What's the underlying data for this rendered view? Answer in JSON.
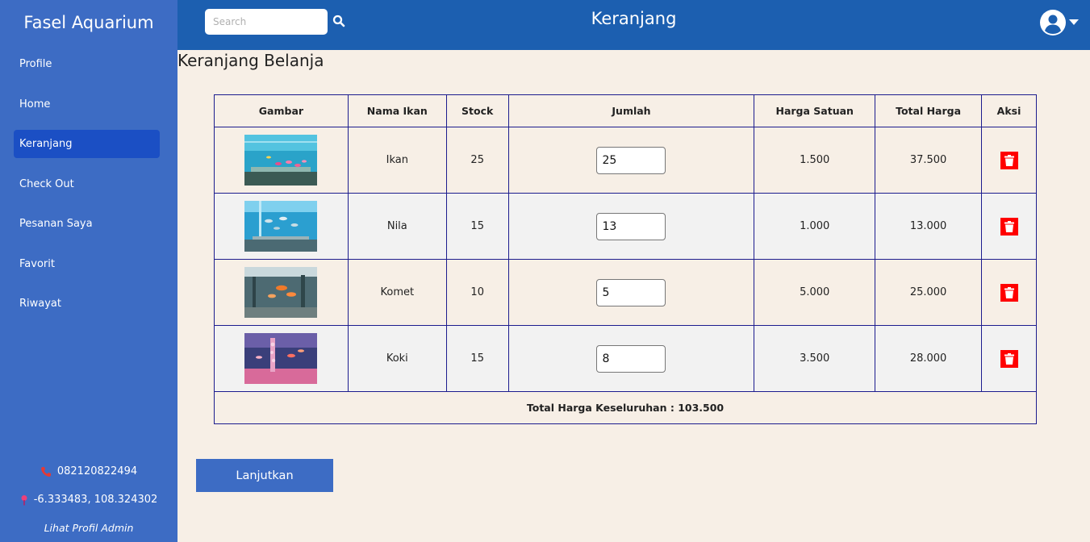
{
  "brand": "Fasel Aquarium",
  "sidebar": {
    "items": [
      {
        "label": "Profile"
      },
      {
        "label": "Home"
      },
      {
        "label": "Keranjang"
      },
      {
        "label": "Check Out"
      },
      {
        "label": "Pesanan Saya"
      },
      {
        "label": "Favorit"
      },
      {
        "label": "Riwayat"
      }
    ],
    "active_item": "Keranjang",
    "phone": "082120822494",
    "location": "-6.333483, 108.324302",
    "admin_link": "Lihat Profil Admin",
    "phone_icon": "phone-icon",
    "location_icon": "map-pin-icon"
  },
  "header": {
    "title": "Keranjang",
    "search_placeholder": "Search",
    "search_icon": "search-icon",
    "user_icon": "user-circle-icon",
    "dropdown_icon": "caret-down-icon"
  },
  "main": {
    "title": "Keranjang Belanja",
    "table": {
      "headers": [
        "Gambar",
        "Nama Ikan",
        "Stock",
        "Jumlah",
        "Harga Satuan",
        "Total Harga",
        "Aksi"
      ],
      "rows": [
        {
          "name": "Ikan",
          "stock": "25",
          "qty": "25",
          "unit_price": "1.500",
          "total": "37.500",
          "image": "aquarium-photo"
        },
        {
          "name": "Nila",
          "stock": "15",
          "qty": "13",
          "unit_price": "1.000",
          "total": "13.000",
          "image": "aquarium-photo"
        },
        {
          "name": "Komet",
          "stock": "10",
          "qty": "5",
          "unit_price": "5.000",
          "total": "25.000",
          "image": "aquarium-photo"
        },
        {
          "name": "Koki",
          "stock": "15",
          "qty": "8",
          "unit_price": "3.500",
          "total": "28.000",
          "image": "aquarium-photo"
        }
      ],
      "grand_total": "Total Harga Keseluruhan : 103.500",
      "delete_icon": "trash-icon"
    },
    "continue_button": "Lanjutkan"
  },
  "colors": {
    "sidebar": "#3d6cc4",
    "sidebar_active": "#1b4fc4",
    "header": "#1c5fb0",
    "page_bg": "#f7efe6",
    "table_border": "#1c1c8e",
    "delete": "#ff0000"
  }
}
